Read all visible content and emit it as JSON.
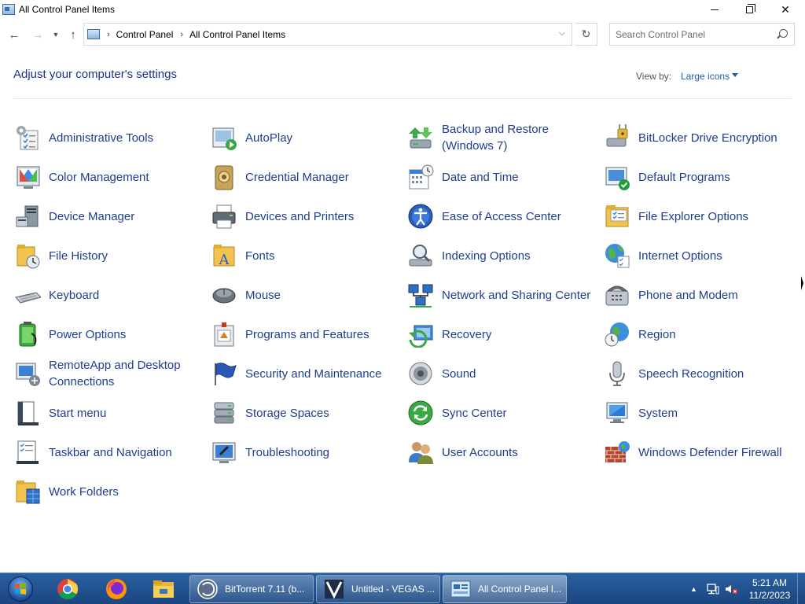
{
  "window": {
    "title": "All Control Panel Items"
  },
  "address": {
    "breadcrumbs": [
      "Control Panel",
      "All Control Panel Items"
    ],
    "search_placeholder": "Search Control Panel"
  },
  "header": {
    "title": "Adjust your computer's settings",
    "view_by_label": "View by:",
    "view_by_value": "Large icons"
  },
  "items": [
    {
      "label": "Administrative Tools",
      "icon": "admin-tools-icon"
    },
    {
      "label": "AutoPlay",
      "icon": "autoplay-icon"
    },
    {
      "label": "Backup and Restore (Windows 7)",
      "icon": "backup-icon"
    },
    {
      "label": "BitLocker Drive Encryption",
      "icon": "bitlocker-icon"
    },
    {
      "label": "Color Management",
      "icon": "color-management-icon"
    },
    {
      "label": "Credential Manager",
      "icon": "credential-manager-icon"
    },
    {
      "label": "Date and Time",
      "icon": "date-time-icon"
    },
    {
      "label": "Default Programs",
      "icon": "default-programs-icon"
    },
    {
      "label": "Device Manager",
      "icon": "device-manager-icon"
    },
    {
      "label": "Devices and Printers",
      "icon": "printer-icon"
    },
    {
      "label": "Ease of Access Center",
      "icon": "ease-of-access-icon"
    },
    {
      "label": "File Explorer Options",
      "icon": "folder-options-icon"
    },
    {
      "label": "File History",
      "icon": "file-history-icon"
    },
    {
      "label": "Fonts",
      "icon": "fonts-icon"
    },
    {
      "label": "Indexing Options",
      "icon": "indexing-icon"
    },
    {
      "label": "Internet Options",
      "icon": "internet-options-icon"
    },
    {
      "label": "Keyboard",
      "icon": "keyboard-icon"
    },
    {
      "label": "Mouse",
      "icon": "mouse-icon"
    },
    {
      "label": "Network and Sharing Center",
      "icon": "network-icon"
    },
    {
      "label": "Phone and Modem",
      "icon": "phone-icon"
    },
    {
      "label": "Power Options",
      "icon": "power-icon"
    },
    {
      "label": "Programs and Features",
      "icon": "programs-icon"
    },
    {
      "label": "Recovery",
      "icon": "recovery-icon"
    },
    {
      "label": "Region",
      "icon": "region-icon"
    },
    {
      "label": "RemoteApp and Desktop Connections",
      "icon": "remoteapp-icon"
    },
    {
      "label": "Security and Maintenance",
      "icon": "security-flag-icon"
    },
    {
      "label": "Sound",
      "icon": "sound-icon"
    },
    {
      "label": "Speech Recognition",
      "icon": "microphone-icon"
    },
    {
      "label": "Start menu",
      "icon": "start-menu-icon"
    },
    {
      "label": "Storage Spaces",
      "icon": "storage-icon"
    },
    {
      "label": "Sync Center",
      "icon": "sync-icon"
    },
    {
      "label": "System",
      "icon": "system-icon"
    },
    {
      "label": "Taskbar and Navigation",
      "icon": "taskbar-icon"
    },
    {
      "label": "Troubleshooting",
      "icon": "troubleshooting-icon"
    },
    {
      "label": "User Accounts",
      "icon": "user-accounts-icon"
    },
    {
      "label": "Windows Defender Firewall",
      "icon": "firewall-icon"
    },
    {
      "label": "Work Folders",
      "icon": "work-folders-icon"
    }
  ],
  "taskbar": {
    "pinned": [
      "chrome-icon",
      "firefox-icon",
      "file-explorer-icon"
    ],
    "tasks": [
      {
        "label": "BitTorrent 7.11  (b...",
        "icon": "bittorrent-icon"
      },
      {
        "label": "Untitled - VEGAS ...",
        "icon": "vegas-icon"
      },
      {
        "label": "All Control Panel I...",
        "icon": "control-panel-icon"
      }
    ],
    "time": "5:21 AM",
    "date": "11/2/2023"
  },
  "colors": {
    "link": "#1e3d8f",
    "heading": "#1e3287",
    "taskbar": "#2a5fa0"
  }
}
